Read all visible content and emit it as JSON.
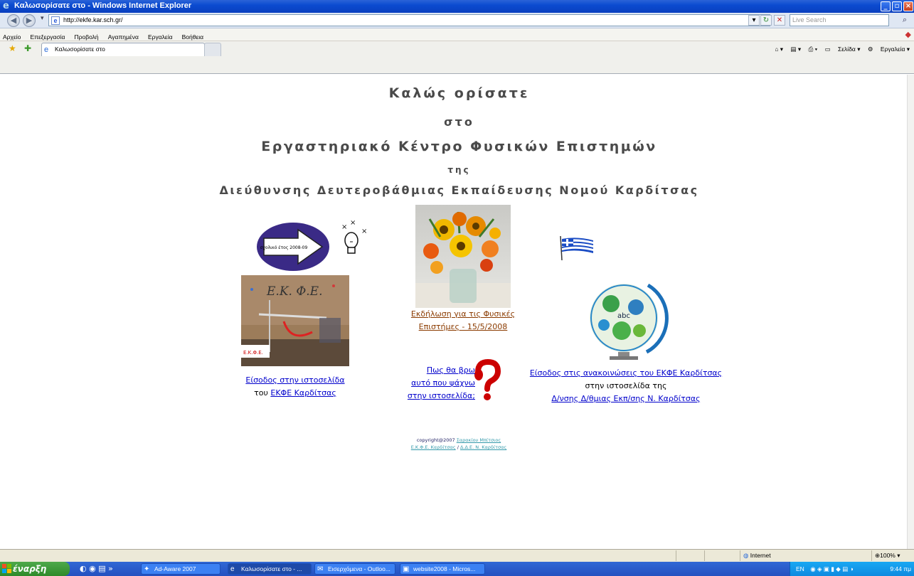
{
  "window": {
    "title": "Καλωσορίσατε στο - Windows Internet Explorer",
    "colors": {
      "titlebar": "#0b4bd0",
      "link": "#0000cc",
      "brown_link": "#8b3b00",
      "heading": "#4a4a4a",
      "taskbar": "#2450c0",
      "start": "#2e8a2a"
    }
  },
  "addressbar": {
    "url": "http://ekfe.kar.sch.gr/",
    "search_placeholder": "Live Search"
  },
  "menu": {
    "items": [
      "Αρχείο",
      "Επεξεργασία",
      "Προβολή",
      "Αγαπημένα",
      "Εργαλεία",
      "Βοήθεια"
    ]
  },
  "tabs": {
    "active_label": "Καλωσορίσατε στο",
    "commands": {
      "page": "Σελίδα",
      "tools": "Εργαλεία"
    }
  },
  "page": {
    "heading1": "Καλώς ορίσατε",
    "heading2": "στο",
    "heading3": "Εργαστηριακό Κέντρο Φυσικών Επιστημών",
    "heading4": "της",
    "heading5": "Διεύθυνσης Δευτεροβάθμιας Εκπαίδευσης Νομού Καρδίτσας",
    "oval_label": "σχολικό έτος 2008-09",
    "lab_image_text": "Ε.Κ. Φ.Ε.",
    "lab_sign_text": "Ε.Κ.Φ.Ε.",
    "event_link_line1": "Εκδήλωση για τις Φυσικές",
    "event_link_line2": "Επιστήμες - 15/5/2008",
    "entry_link": "Είσοδος στην ιστοσελίδα",
    "entry_line2_prefix": "του ",
    "entry_line2_link": "ΕΚΦΕ Καρδίτσας",
    "howto_line1": "Πως θα βρω",
    "howto_line2": "αυτό που ψάχνω",
    "howto_line3": "στην ιστοσελίδα;",
    "announce_link": "Είσοδος στις ανακοινώσεις του ΕΚΦΕ Καρδίτσας",
    "announce_line2": "στην ιστοσελίδα της",
    "announce_line3_link": "Δ/νσης Δ/θμιας Εκπ/σης Ν. Καρδίτσας",
    "copyright_prefix": "copyright@2007 ",
    "copyright_author": "Σαρακίου Μπίτσιος",
    "copyright_link1": "Ε.Κ.Φ.Ε. Καρδίτσας",
    "copyright_sep": " / ",
    "copyright_link2": "Δ.Δ.Ε. Ν. Καρδίτσας"
  },
  "status": {
    "zone": "Internet",
    "zoom": "100%"
  },
  "taskbar": {
    "start": "έναρξη",
    "buttons": [
      "Ad-Aware 2007",
      "Καλωσορίσατε στο - ...",
      "Εισερχόμενα - Outloo...",
      "website2008 - Micros..."
    ],
    "lang": "EN",
    "clock": "9:44 πμ"
  }
}
